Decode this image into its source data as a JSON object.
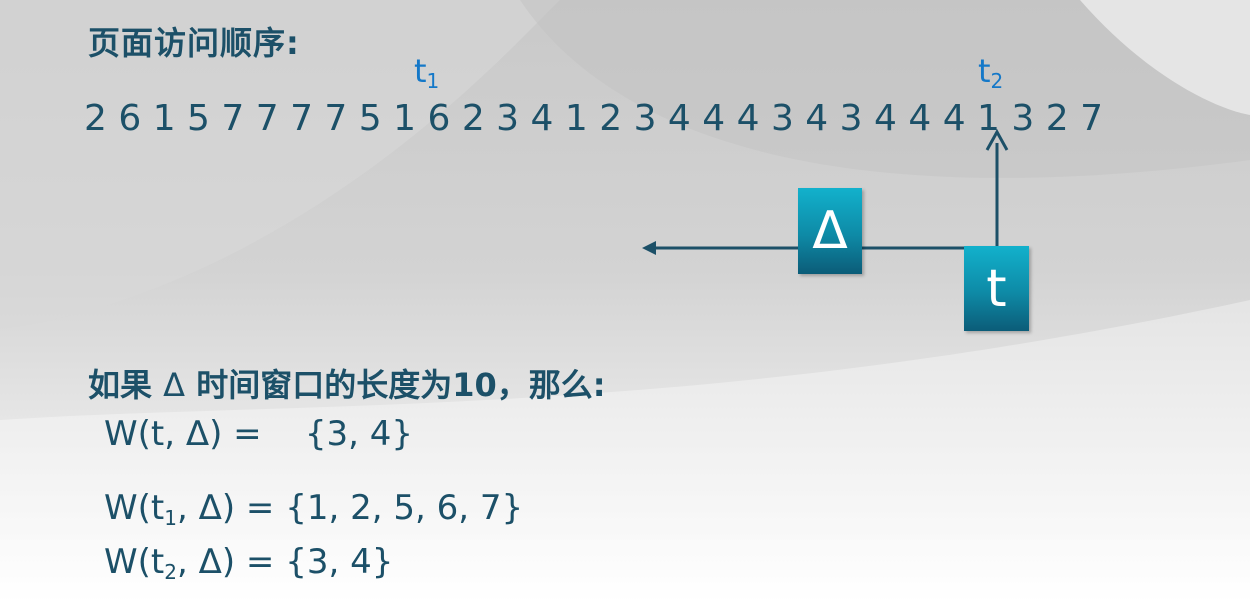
{
  "heading": "页面访问顺序:",
  "sequence": "2 6 1 5 7 7 7 7 5 1 6 2 3 4 1 2 3 4 4 4 3 4 3 4 4 4 1 3 2 7",
  "marks": {
    "t1": {
      "base": "t",
      "sub": "1"
    },
    "t2": {
      "base": "t",
      "sub": "2"
    }
  },
  "boxes": {
    "delta": "Δ",
    "t": "t"
  },
  "condition": {
    "pre": "如果",
    "delta": "Δ",
    "post": "时间窗口的长度为10，那么:"
  },
  "formulas": {
    "w_t": {
      "left": "W(t, Δ) = ",
      "right": "{3, 4}"
    },
    "w_t1": {
      "pre": "W(t",
      "sub": "1",
      "post": ", Δ) = {1, 2, 5, 6, 7}"
    },
    "w_t2": {
      "pre": "W(t",
      "sub": "2",
      "post": ", Δ) = {3, 4}"
    }
  },
  "colors": {
    "text": "#1c5068",
    "mark": "#1478c8",
    "box_top": "#12b1cc",
    "box_bottom": "#0b5c78"
  }
}
